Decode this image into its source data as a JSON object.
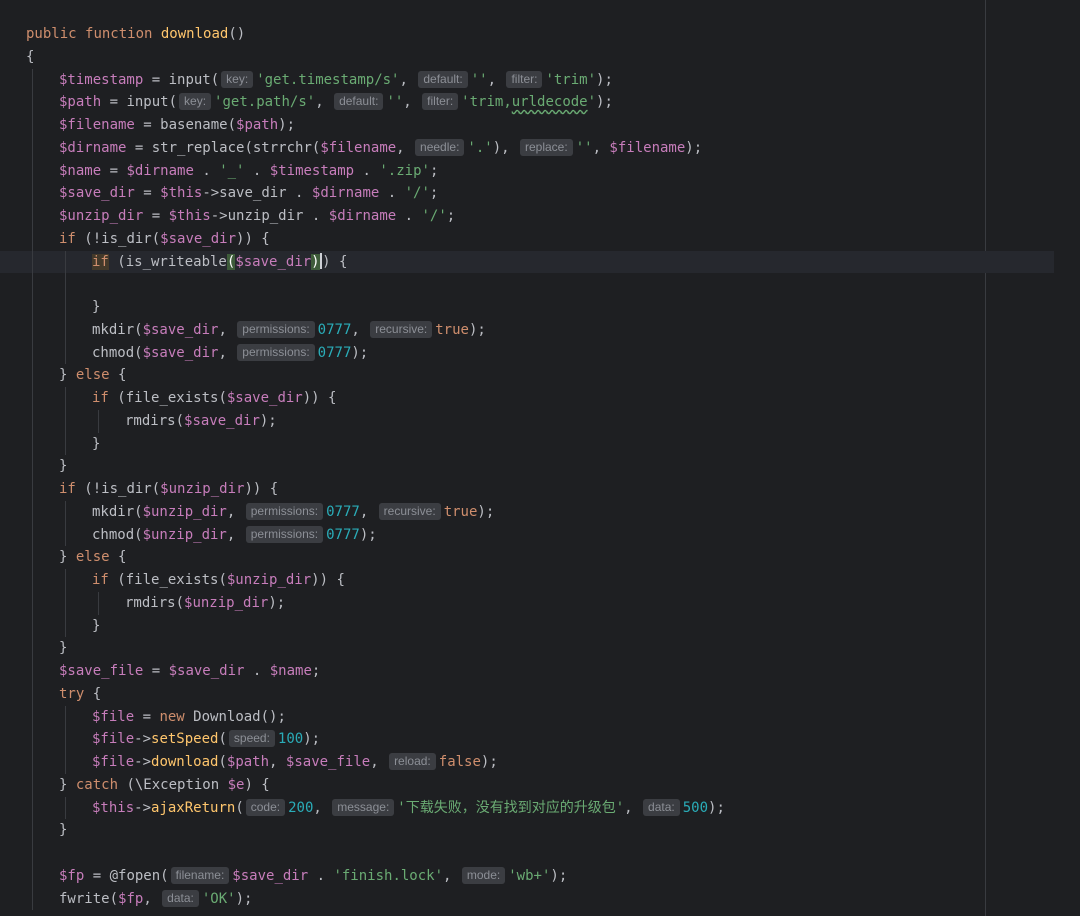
{
  "editor": {
    "lines": [
      {
        "id": "l1",
        "tokens": [
          [
            "kw",
            "public "
          ],
          [
            "kw",
            "function "
          ],
          [
            "decl",
            "download"
          ],
          [
            "ph",
            "()"
          ]
        ]
      },
      {
        "id": "l2",
        "tokens": [
          [
            "ph",
            "{"
          ]
        ]
      },
      {
        "id": "l3",
        "indent": 1,
        "tokens": [
          [
            "var",
            "$timestamp"
          ],
          [
            "ph",
            " = "
          ],
          [
            "call",
            "input("
          ],
          [
            "hint",
            "key:"
          ],
          [
            "str",
            "'get.timestamp/s'"
          ],
          [
            "ph",
            ", "
          ],
          [
            "hint",
            "default:"
          ],
          [
            "str",
            "''"
          ],
          [
            "ph",
            ", "
          ],
          [
            "hint",
            "filter:"
          ],
          [
            "str",
            "'trim'"
          ],
          [
            "ph",
            ");"
          ]
        ]
      },
      {
        "id": "l4",
        "indent": 1,
        "tokens": [
          [
            "var",
            "$path"
          ],
          [
            "ph",
            " = "
          ],
          [
            "call",
            "input("
          ],
          [
            "hint",
            "key:"
          ],
          [
            "str",
            "'get.path/s'"
          ],
          [
            "ph",
            ", "
          ],
          [
            "hint",
            "default:"
          ],
          [
            "str",
            "''"
          ],
          [
            "ph",
            ", "
          ],
          [
            "hint",
            "filter:"
          ],
          [
            "str",
            "'trim,"
          ],
          [
            "strsq",
            "urldecode"
          ],
          [
            "str",
            "'"
          ],
          [
            "ph",
            ");"
          ]
        ]
      },
      {
        "id": "l5",
        "indent": 1,
        "tokens": [
          [
            "var",
            "$filename"
          ],
          [
            "ph",
            " = "
          ],
          [
            "call",
            "basename("
          ],
          [
            "var",
            "$path"
          ],
          [
            "ph",
            ");"
          ]
        ]
      },
      {
        "id": "l6",
        "indent": 1,
        "tokens": [
          [
            "var",
            "$dirname"
          ],
          [
            "ph",
            " = "
          ],
          [
            "call",
            "str_replace(strrchr("
          ],
          [
            "var",
            "$filename"
          ],
          [
            "ph",
            ", "
          ],
          [
            "hint",
            "needle:"
          ],
          [
            "str",
            "'.'"
          ],
          [
            "ph",
            "), "
          ],
          [
            "hint",
            "replace:"
          ],
          [
            "str",
            "''"
          ],
          [
            "ph",
            ", "
          ],
          [
            "var",
            "$filename"
          ],
          [
            "ph",
            ");"
          ]
        ]
      },
      {
        "id": "l7",
        "indent": 1,
        "tokens": [
          [
            "var",
            "$name"
          ],
          [
            "ph",
            " = "
          ],
          [
            "var",
            "$dirname"
          ],
          [
            "ph",
            " . "
          ],
          [
            "str",
            "'_'"
          ],
          [
            "ph",
            " . "
          ],
          [
            "var",
            "$timestamp"
          ],
          [
            "ph",
            " . "
          ],
          [
            "str",
            "'.zip'"
          ],
          [
            "ph",
            ";"
          ]
        ]
      },
      {
        "id": "l8",
        "indent": 1,
        "tokens": [
          [
            "var",
            "$save_dir"
          ],
          [
            "ph",
            " = "
          ],
          [
            "var",
            "$this"
          ],
          [
            "ph",
            "->save_dir . "
          ],
          [
            "var",
            "$dirname"
          ],
          [
            "ph",
            " . "
          ],
          [
            "str",
            "'/'"
          ],
          [
            "ph",
            ";"
          ]
        ]
      },
      {
        "id": "l9",
        "indent": 1,
        "tokens": [
          [
            "var",
            "$unzip_dir"
          ],
          [
            "ph",
            " = "
          ],
          [
            "var",
            "$this"
          ],
          [
            "ph",
            "->unzip_dir . "
          ],
          [
            "var",
            "$dirname"
          ],
          [
            "ph",
            " . "
          ],
          [
            "str",
            "'/'"
          ],
          [
            "ph",
            ";"
          ]
        ]
      },
      {
        "id": "l10",
        "indent": 1,
        "tokens": [
          [
            "kw",
            "if "
          ],
          [
            "ph",
            "(!is_dir("
          ],
          [
            "var",
            "$save_dir"
          ],
          [
            "ph",
            ")) {"
          ]
        ]
      },
      {
        "id": "l11",
        "indent": 2,
        "current": true,
        "tokens": [
          [
            "kwhl",
            "if"
          ],
          [
            "ph",
            " (is_writeable"
          ],
          [
            "parenhl",
            "("
          ],
          [
            "var",
            "$save_dir"
          ],
          [
            "parenhl",
            ")"
          ],
          [
            "caret",
            ""
          ],
          [
            "ph",
            ") {"
          ]
        ]
      },
      {
        "id": "l12",
        "indent": 2,
        "tokens": []
      },
      {
        "id": "l13",
        "indent": 2,
        "tokens": [
          [
            "ph",
            "}"
          ]
        ]
      },
      {
        "id": "l14",
        "indent": 2,
        "tokens": [
          [
            "call",
            "mkdir("
          ],
          [
            "var",
            "$save_dir"
          ],
          [
            "ph",
            ", "
          ],
          [
            "hint",
            "permissions:"
          ],
          [
            "num",
            "0777"
          ],
          [
            "ph",
            ", "
          ],
          [
            "hint",
            "recursive:"
          ],
          [
            "kw",
            "true"
          ],
          [
            "ph",
            ");"
          ]
        ]
      },
      {
        "id": "l15",
        "indent": 2,
        "tokens": [
          [
            "call",
            "chmod("
          ],
          [
            "var",
            "$save_dir"
          ],
          [
            "ph",
            ", "
          ],
          [
            "hint",
            "permissions:"
          ],
          [
            "num",
            "0777"
          ],
          [
            "ph",
            ");"
          ]
        ]
      },
      {
        "id": "l16",
        "indent": 1,
        "tokens": [
          [
            "ph",
            "} "
          ],
          [
            "kw",
            "else "
          ],
          [
            "ph",
            "{"
          ]
        ]
      },
      {
        "id": "l17",
        "indent": 2,
        "tokens": [
          [
            "kw",
            "if "
          ],
          [
            "ph",
            "(file_exists("
          ],
          [
            "var",
            "$save_dir"
          ],
          [
            "ph",
            ")) {"
          ]
        ]
      },
      {
        "id": "l18",
        "indent": 3,
        "tokens": [
          [
            "call",
            "rmdirs("
          ],
          [
            "var",
            "$save_dir"
          ],
          [
            "ph",
            ");"
          ]
        ]
      },
      {
        "id": "l19",
        "indent": 2,
        "tokens": [
          [
            "ph",
            "}"
          ]
        ]
      },
      {
        "id": "l20",
        "indent": 1,
        "tokens": [
          [
            "ph",
            "}"
          ]
        ]
      },
      {
        "id": "l21",
        "indent": 1,
        "tokens": [
          [
            "kw",
            "if "
          ],
          [
            "ph",
            "(!is_dir("
          ],
          [
            "var",
            "$unzip_dir"
          ],
          [
            "ph",
            ")) {"
          ]
        ]
      },
      {
        "id": "l22",
        "indent": 2,
        "tokens": [
          [
            "call",
            "mkdir("
          ],
          [
            "var",
            "$unzip_dir"
          ],
          [
            "ph",
            ", "
          ],
          [
            "hint",
            "permissions:"
          ],
          [
            "num",
            "0777"
          ],
          [
            "ph",
            ", "
          ],
          [
            "hint",
            "recursive:"
          ],
          [
            "kw",
            "true"
          ],
          [
            "ph",
            ");"
          ]
        ]
      },
      {
        "id": "l23",
        "indent": 2,
        "tokens": [
          [
            "call",
            "chmod("
          ],
          [
            "var",
            "$unzip_dir"
          ],
          [
            "ph",
            ", "
          ],
          [
            "hint",
            "permissions:"
          ],
          [
            "num",
            "0777"
          ],
          [
            "ph",
            ");"
          ]
        ]
      },
      {
        "id": "l24",
        "indent": 1,
        "tokens": [
          [
            "ph",
            "} "
          ],
          [
            "kw",
            "else "
          ],
          [
            "ph",
            "{"
          ]
        ]
      },
      {
        "id": "l25",
        "indent": 2,
        "tokens": [
          [
            "kw",
            "if "
          ],
          [
            "ph",
            "(file_exists("
          ],
          [
            "var",
            "$unzip_dir"
          ],
          [
            "ph",
            ")) {"
          ]
        ]
      },
      {
        "id": "l26",
        "indent": 3,
        "tokens": [
          [
            "call",
            "rmdirs("
          ],
          [
            "var",
            "$unzip_dir"
          ],
          [
            "ph",
            ");"
          ]
        ]
      },
      {
        "id": "l27",
        "indent": 2,
        "tokens": [
          [
            "ph",
            "}"
          ]
        ]
      },
      {
        "id": "l28",
        "indent": 1,
        "tokens": [
          [
            "ph",
            "}"
          ]
        ]
      },
      {
        "id": "l29",
        "indent": 1,
        "tokens": [
          [
            "var",
            "$save_file"
          ],
          [
            "ph",
            " = "
          ],
          [
            "var",
            "$save_dir"
          ],
          [
            "ph",
            " . "
          ],
          [
            "var",
            "$name"
          ],
          [
            "ph",
            ";"
          ]
        ]
      },
      {
        "id": "l30",
        "indent": 1,
        "tokens": [
          [
            "kw",
            "try "
          ],
          [
            "ph",
            "{"
          ]
        ]
      },
      {
        "id": "l31",
        "indent": 2,
        "tokens": [
          [
            "var",
            "$file"
          ],
          [
            "ph",
            " = "
          ],
          [
            "kw",
            "new "
          ],
          [
            "ph",
            "Download();"
          ]
        ]
      },
      {
        "id": "l32",
        "indent": 2,
        "tokens": [
          [
            "var",
            "$file"
          ],
          [
            "ph",
            "->"
          ],
          [
            "mcall",
            "setSpeed"
          ],
          [
            "ph",
            "("
          ],
          [
            "hint",
            "speed:"
          ],
          [
            "num",
            "100"
          ],
          [
            "ph",
            ");"
          ]
        ]
      },
      {
        "id": "l33",
        "indent": 2,
        "tokens": [
          [
            "var",
            "$file"
          ],
          [
            "ph",
            "->"
          ],
          [
            "mcall",
            "download"
          ],
          [
            "ph",
            "("
          ],
          [
            "var",
            "$path"
          ],
          [
            "ph",
            ", "
          ],
          [
            "var",
            "$save_file"
          ],
          [
            "ph",
            ", "
          ],
          [
            "hint",
            "reload:"
          ],
          [
            "kw",
            "false"
          ],
          [
            "ph",
            ");"
          ]
        ]
      },
      {
        "id": "l34",
        "indent": 1,
        "tokens": [
          [
            "ph",
            "} "
          ],
          [
            "kw",
            "catch "
          ],
          [
            "ph",
            "(\\Exception "
          ],
          [
            "var",
            "$e"
          ],
          [
            "ph",
            ") {"
          ]
        ]
      },
      {
        "id": "l35",
        "indent": 2,
        "tokens": [
          [
            "var",
            "$this"
          ],
          [
            "ph",
            "->"
          ],
          [
            "mcall",
            "ajaxReturn"
          ],
          [
            "ph",
            "("
          ],
          [
            "hint",
            "code:"
          ],
          [
            "num",
            "200"
          ],
          [
            "ph",
            ", "
          ],
          [
            "hint",
            "message:"
          ],
          [
            "str",
            "'下载失败，没有找到对应的升级包'"
          ],
          [
            "ph",
            ", "
          ],
          [
            "hint",
            "data:"
          ],
          [
            "num",
            "500"
          ],
          [
            "ph",
            ");"
          ]
        ]
      },
      {
        "id": "l36",
        "indent": 1,
        "tokens": [
          [
            "ph",
            "}"
          ]
        ]
      },
      {
        "id": "l37",
        "indent": 1,
        "tokens": []
      },
      {
        "id": "l38",
        "indent": 1,
        "tokens": [
          [
            "var",
            "$fp"
          ],
          [
            "ph",
            " = @fopen("
          ],
          [
            "hint",
            "filename:"
          ],
          [
            "var",
            "$save_dir"
          ],
          [
            "ph",
            " . "
          ],
          [
            "str",
            "'finish.lock'"
          ],
          [
            "ph",
            ", "
          ],
          [
            "hint",
            "mode:"
          ],
          [
            "str",
            "'wb+'"
          ],
          [
            "ph",
            ");"
          ]
        ]
      },
      {
        "id": "l39",
        "indent": 1,
        "tokens": [
          [
            "call",
            "fwrite("
          ],
          [
            "var",
            "$fp"
          ],
          [
            "ph",
            ", "
          ],
          [
            "hint",
            "data:"
          ],
          [
            "str",
            "'OK'"
          ],
          [
            "ph",
            ");"
          ]
        ]
      }
    ]
  }
}
